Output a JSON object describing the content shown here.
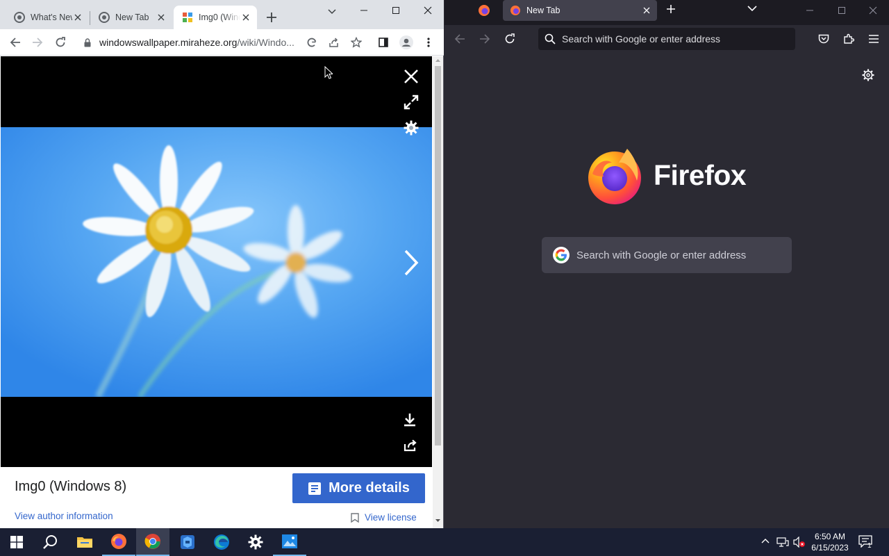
{
  "chrome": {
    "tabs": [
      {
        "title": "What's New"
      },
      {
        "title": "New Tab"
      },
      {
        "title": "Img0 (Windows 8)"
      }
    ],
    "url_host": "windowswallpaper.miraheze.org",
    "url_path": "/wiki/Windo...",
    "viewer": {
      "image_title": "Img0 (Windows 8)",
      "more_details_label": "More details",
      "author_link": "View author information",
      "license_link": "View license"
    }
  },
  "firefox": {
    "tab_title": "New Tab",
    "urlbar_placeholder": "Search with Google or enter address",
    "brand": "Firefox",
    "search_placeholder": "Search with Google or enter address"
  },
  "taskbar": {
    "apps": [
      "start-icon",
      "search-icon",
      "file-explorer-icon",
      "firefox-icon",
      "chrome-icon",
      "app-icon",
      "edge-icon",
      "settings-icon",
      "photos-icon"
    ],
    "time": "6:50 AM",
    "date": "6/15/2023",
    "notification_count": "1"
  },
  "colors": {
    "chrome_titlebar": "#dee1e6",
    "firefox_bg": "#2b2a33",
    "more_details_button": "#3366cc",
    "taskbar": "#1a1f33"
  }
}
